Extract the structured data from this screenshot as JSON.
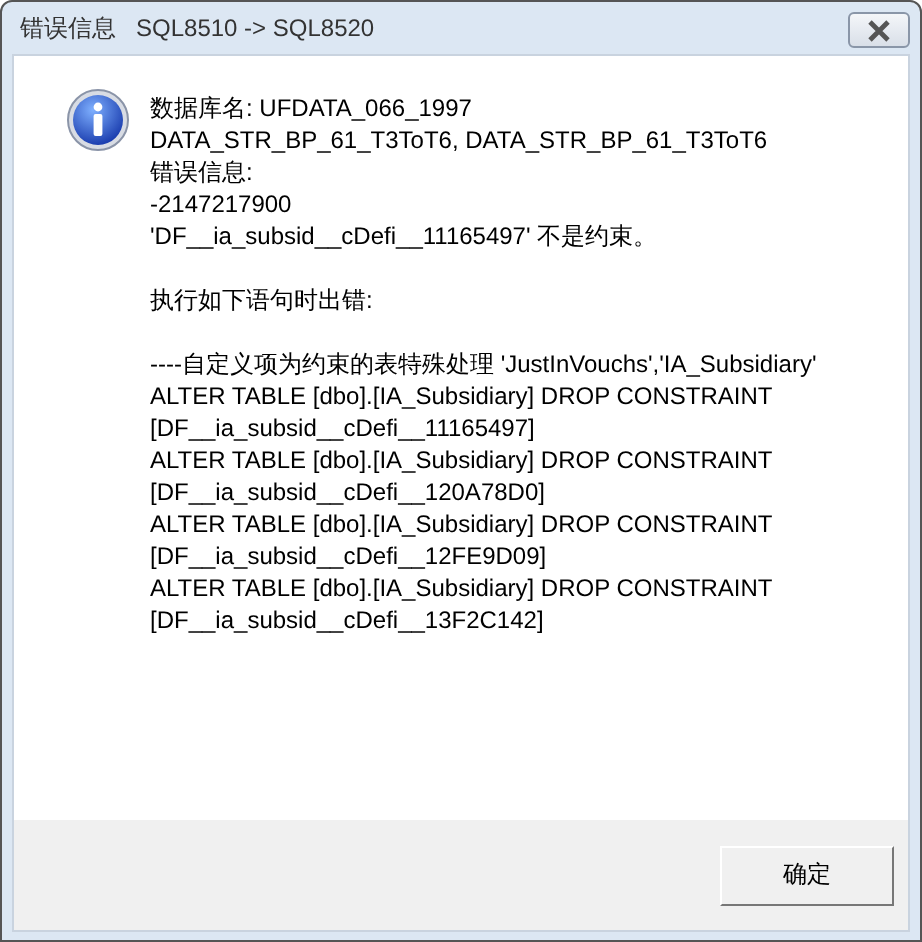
{
  "window": {
    "title": "错误信息   SQL8510 -> SQL8520"
  },
  "message": {
    "paragraphs": [
      [
        "数据库名: UFDATA_066_1997",
        "DATA_STR_BP_61_T3ToT6, DATA_STR_BP_61_T3ToT6",
        "错误信息:",
        "-2147217900",
        "'DF__ia_subsid__cDefi__11165497' 不是约束。"
      ],
      [
        "执行如下语句时出错:"
      ],
      [
        "----自定义项为约束的表特殊处理 'JustInVouchs','IA_Subsidiary'",
        "ALTER TABLE [dbo].[IA_Subsidiary] DROP CONSTRAINT",
        "[DF__ia_subsid__cDefi__11165497]",
        "ALTER TABLE [dbo].[IA_Subsidiary] DROP CONSTRAINT",
        "[DF__ia_subsid__cDefi__120A78D0]",
        "ALTER TABLE [dbo].[IA_Subsidiary] DROP CONSTRAINT",
        "[DF__ia_subsid__cDefi__12FE9D09]",
        "ALTER TABLE [dbo].[IA_Subsidiary] DROP CONSTRAINT",
        "[DF__ia_subsid__cDefi__13F2C142]"
      ]
    ]
  },
  "buttons": [
    "确定"
  ]
}
